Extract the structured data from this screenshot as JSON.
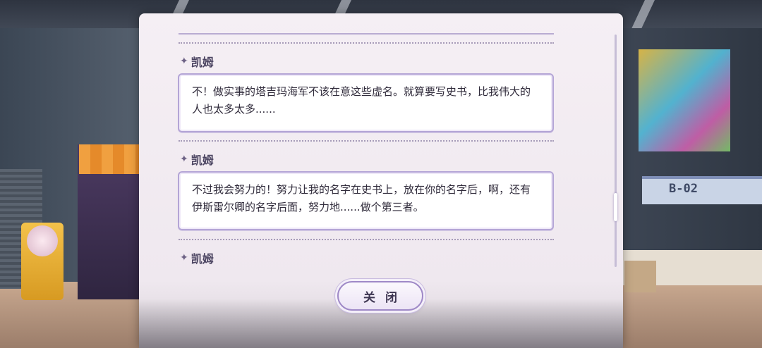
{
  "scene": {
    "sign_text": "B-02"
  },
  "dialog": {
    "entries": [
      {
        "speaker": "凯姆",
        "text": "不！做实事的塔吉玛海军不该在意这些虚名。就算要写史书，比我伟大的人也太多太多......"
      },
      {
        "speaker": "凯姆",
        "text": "不过我会努力的！努力让我的名字在史书上，放在你的名字后，啊，还有伊斯雷尔卿的名字后面，努力地......做个第三者。"
      },
      {
        "speaker": "凯姆",
        "text": ""
      }
    ],
    "close_label": "关闭"
  },
  "icons": {
    "speaker_marker": "sparkle-icon"
  },
  "colors": {
    "panel_bg": "#f5eff4",
    "bubble_border": "#b4a5d6",
    "speaker_text": "#4a4360"
  }
}
